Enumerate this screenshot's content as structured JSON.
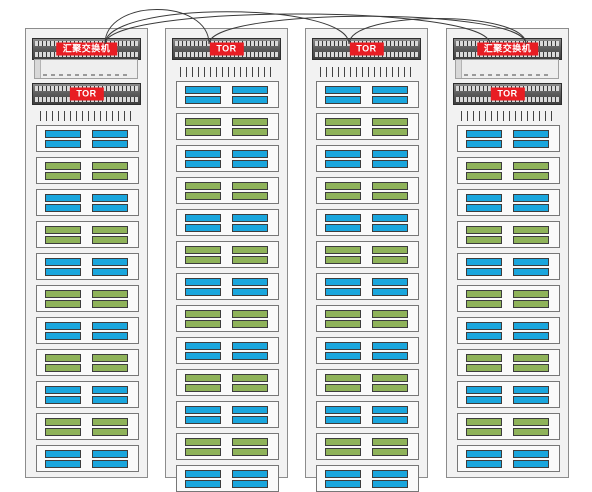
{
  "caption": "",
  "labels": {
    "aggregation": "汇聚交换机",
    "tor": "TOR"
  },
  "racks": [
    {
      "name": "rack-1",
      "switches": [
        "aggregation",
        "tor"
      ],
      "servers": [
        "blue",
        "green",
        "blue",
        "green",
        "blue",
        "green",
        "blue",
        "green",
        "blue",
        "green",
        "blue"
      ]
    },
    {
      "name": "rack-2",
      "switches": [
        "tor"
      ],
      "servers": [
        "blue",
        "green",
        "blue",
        "green",
        "blue",
        "green",
        "blue",
        "green",
        "blue",
        "green",
        "blue",
        "green",
        "blue"
      ]
    },
    {
      "name": "rack-3",
      "switches": [
        "tor"
      ],
      "servers": [
        "blue",
        "green",
        "blue",
        "green",
        "blue",
        "green",
        "blue",
        "green",
        "blue",
        "green",
        "blue",
        "green",
        "blue"
      ]
    },
    {
      "name": "rack-4",
      "switches": [
        "aggregation",
        "tor"
      ],
      "servers": [
        "blue",
        "green",
        "blue",
        "green",
        "blue",
        "green",
        "blue",
        "green",
        "blue",
        "green",
        "blue"
      ]
    }
  ],
  "links": [
    {
      "from": "rack-1-aggregation",
      "to": "rack-2-tor"
    },
    {
      "from": "rack-1-aggregation",
      "to": "rack-3-tor"
    },
    {
      "from": "rack-1-aggregation",
      "to": "rack-4-aggregation"
    },
    {
      "from": "rack-4-aggregation",
      "to": "rack-2-tor"
    },
    {
      "from": "rack-4-aggregation",
      "to": "rack-3-tor"
    }
  ],
  "colors": {
    "label_bg": "#e81d23",
    "disk_blue": "#1aa6dd",
    "disk_green": "#8fb35a"
  }
}
